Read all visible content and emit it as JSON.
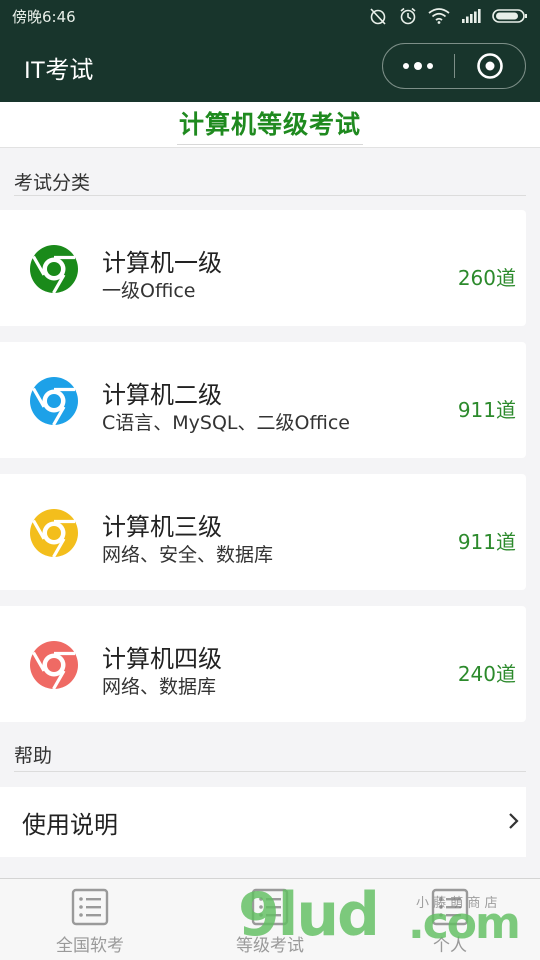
{
  "status_bar": {
    "time": "傍晚6:46",
    "icons": [
      "alarm-off-icon",
      "alarm-icon",
      "wifi-icon",
      "signal-icon",
      "battery-icon"
    ]
  },
  "nav": {
    "title": "IT考试",
    "more_icon": "more-dots-icon",
    "close_icon": "target-close-icon"
  },
  "header": {
    "title": "计算机等级考试"
  },
  "sections": {
    "categories_label": "考试分类",
    "help_label": "帮助"
  },
  "exams": [
    {
      "title": "计算机一级",
      "subtitle": "一级Office",
      "count": "260道",
      "icon": "chrome-icon",
      "color": "#1a8a1a"
    },
    {
      "title": "计算机二级",
      "subtitle": "C语言、MySQL、二级Office",
      "count": "911道",
      "icon": "chrome-icon",
      "color": "#1da1e8"
    },
    {
      "title": "计算机三级",
      "subtitle": "网络、安全、数据库",
      "count": "911道",
      "icon": "chrome-icon",
      "color": "#f3be1c"
    },
    {
      "title": "计算机四级",
      "subtitle": "网络、数据库",
      "count": "240道",
      "icon": "chrome-icon",
      "color": "#ef6a64"
    }
  ],
  "help": {
    "item_label": "使用说明",
    "chevron": "chevron-right-icon"
  },
  "tabs": [
    {
      "label": "全国软考",
      "icon": "list-icon"
    },
    {
      "label": "等级考试",
      "icon": "list-icon"
    },
    {
      "label": "个人",
      "icon": "list-icon"
    }
  ],
  "watermark": {
    "main": "9lud",
    "suffix": ".com",
    "small": "小 藤 萌 商 店"
  },
  "colors": {
    "nav_bg": "#18352c",
    "accent_green": "#1f8a1f",
    "count_green": "#2c8a2c"
  }
}
